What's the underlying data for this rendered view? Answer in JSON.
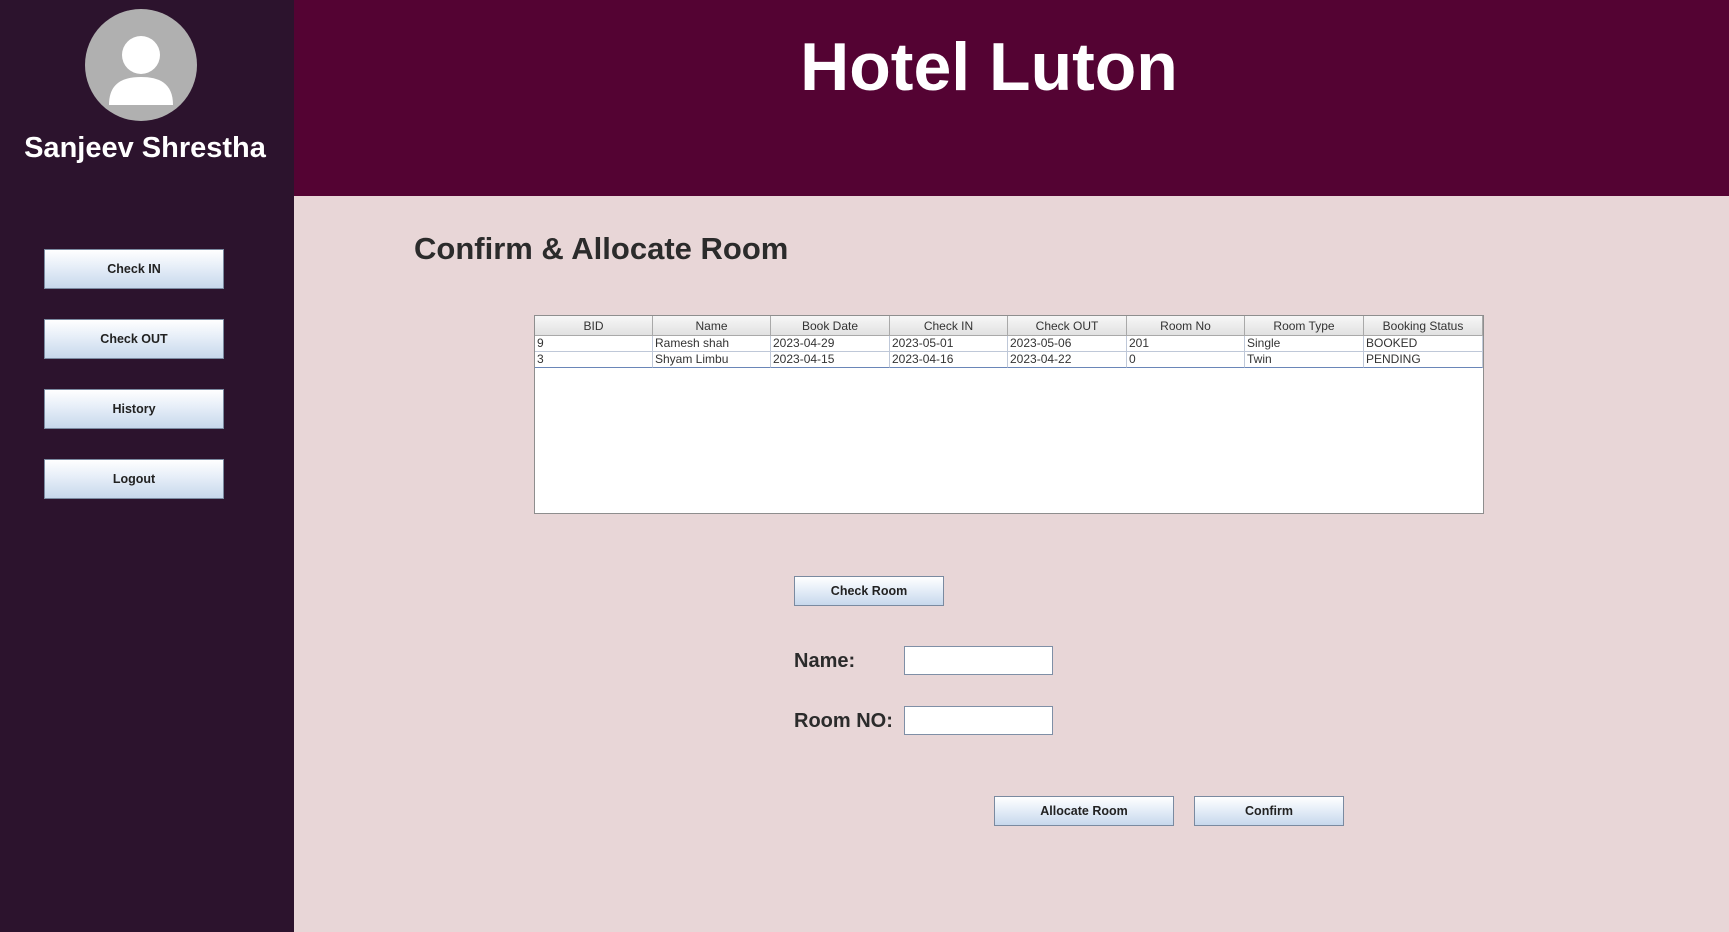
{
  "app": {
    "title": "Hotel Luton"
  },
  "user": {
    "name": "Sanjeev Shrestha",
    "avatar_icon": "user-avatar-icon"
  },
  "sidebar": {
    "items": [
      {
        "label": "Check IN"
      },
      {
        "label": "Check OUT"
      },
      {
        "label": "History"
      },
      {
        "label": "Logout"
      }
    ]
  },
  "main": {
    "section_title": "Confirm & Allocate Room",
    "table": {
      "columns": [
        "BID",
        "Name",
        "Book Date",
        "Check IN",
        "Check OUT",
        "Room No",
        "Room Type",
        "Booking Status"
      ],
      "rows": [
        [
          "9",
          "Ramesh shah",
          "2023-04-29",
          "2023-05-01",
          "2023-05-06",
          "201",
          "Single",
          "BOOKED"
        ],
        [
          "3",
          "Shyam Limbu",
          "2023-04-15",
          "2023-04-16",
          "2023-04-22",
          "0",
          "Twin",
          "PENDING"
        ]
      ]
    },
    "check_room_label": "Check Room",
    "form": {
      "name_label": "Name:",
      "name_value": "",
      "room_label": "Room NO:",
      "room_value": ""
    },
    "allocate_label": "Allocate Room",
    "confirm_label": "Confirm"
  },
  "colors": {
    "sidebar_bg": "#2c132d",
    "header_bg": "#540333",
    "content_bg": "#e8d6d7"
  }
}
